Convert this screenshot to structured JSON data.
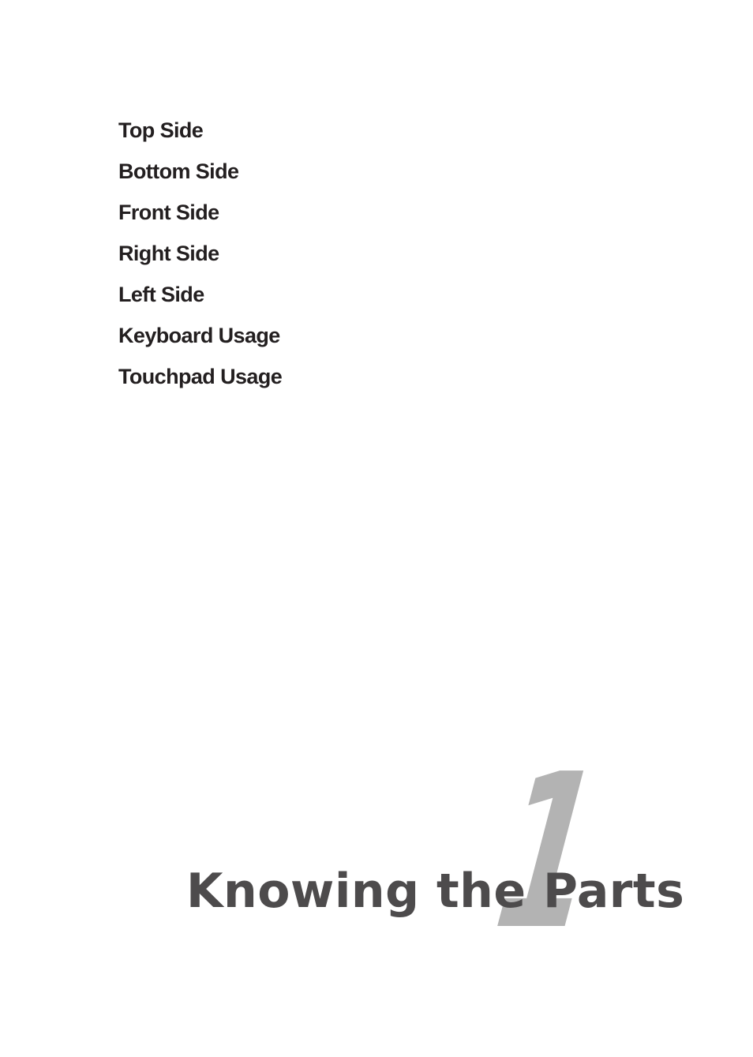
{
  "chapter": {
    "number": "1",
    "title": "Knowing the Parts"
  },
  "toc": {
    "items": [
      {
        "label": "Top Side"
      },
      {
        "label": "Bottom Side"
      },
      {
        "label": "Front Side"
      },
      {
        "label": "Right Side"
      },
      {
        "label": "Left Side"
      },
      {
        "label": "Keyboard Usage"
      },
      {
        "label": "Touchpad Usage"
      }
    ]
  },
  "colors": {
    "toc_text": "#231f20",
    "title_text": "#4d4b4c",
    "chapter_number": "#b3b3b3"
  }
}
